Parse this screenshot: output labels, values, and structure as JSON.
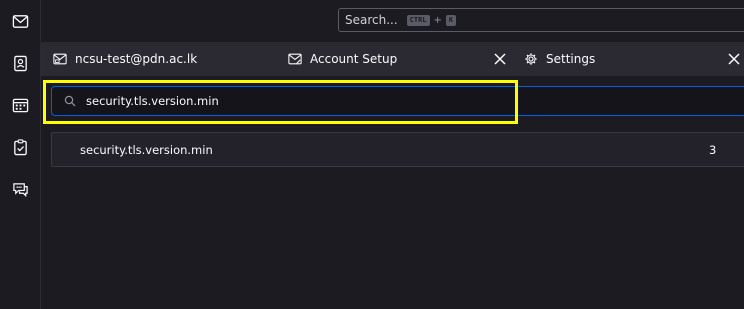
{
  "spaces": [
    {
      "name": "mail-icon"
    },
    {
      "name": "address-book-icon"
    },
    {
      "name": "calendar-icon"
    },
    {
      "name": "tasks-icon"
    },
    {
      "name": "chat-icon"
    }
  ],
  "search": {
    "label": "Search...",
    "key1": "CTRL",
    "plus": "+",
    "key2": "K"
  },
  "tabs": [
    {
      "label": "ncsu-test@pdn.ac.lk",
      "icon": "mail-tab-icon"
    },
    {
      "label": "Account Setup",
      "icon": "account-setup-icon"
    },
    {
      "label": "Settings",
      "icon": "gear-icon"
    }
  ],
  "config": {
    "filter_value": "security.tls.version.min",
    "results": [
      {
        "name": "security.tls.version.min",
        "value": "3"
      }
    ]
  },
  "colors": {
    "highlight": "#ffff00",
    "accent": "#0060df"
  }
}
